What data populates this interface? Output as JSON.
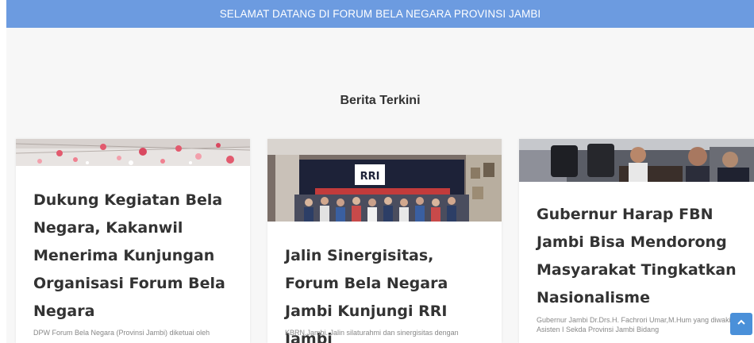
{
  "header": {
    "title": "SELAMAT DATANG DI FORUM BELA NEGARA PROVINSI JAMBI"
  },
  "section": {
    "title": "Berita Terkini"
  },
  "posts": [
    {
      "title": "Dukung Kegiatan Bela Negara, Kakanwil Menerima Kunjungan Organisasi Forum Bela Negara",
      "excerpt": "DPW Forum Bela Negara (Provinsi Jambi) diketuai oleh"
    },
    {
      "title": "Jalin Sinergisitas, Forum Bela Negara Jambi Kunjungi RRI Jambi",
      "excerpt": "KBRN.Jambi. Jalin silaturahmi dan sinergisitas dengan"
    },
    {
      "title": "Gubernur Harap FBN Jambi Bisa Mendorong Masyarakat Tingkatkan Nasionalisme",
      "excerpt": "Gubernur Jambi Dr.Drs.H. Fachrori Umar,M.Hum yang diwakili Asisten I Sekda Provinsi Jambi Bidang"
    }
  ],
  "colors": {
    "header_bg": "#6c9be0",
    "scroll_button": "#4a90d9"
  },
  "icons": {
    "scroll_top": "chevron-up-icon"
  }
}
